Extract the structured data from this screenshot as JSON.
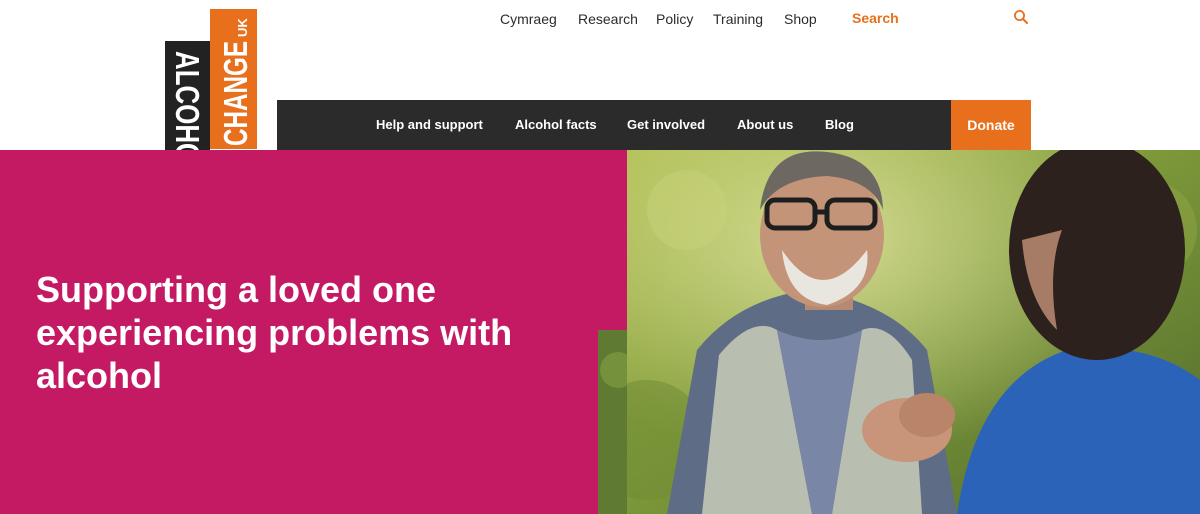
{
  "utility_nav": {
    "links": [
      "Cymraeg",
      "Research",
      "Policy",
      "Training",
      "Shop"
    ],
    "search_label": "Search",
    "search_icon": "search-icon"
  },
  "logo": {
    "word_one": "ALCOHOL",
    "word_two": "CHANGE",
    "suffix": "UK",
    "colors": {
      "dark": "#222222",
      "orange": "#e8701c"
    }
  },
  "main_nav": {
    "links": [
      "Help and support",
      "Alcohol facts",
      "Get involved",
      "About us",
      "Blog"
    ],
    "donate_label": "Donate"
  },
  "hero": {
    "title": "Supporting a loved one experiencing problems with alcohol",
    "image": "photo-older-man-holding-hands-with-woman-outdoors"
  },
  "colors": {
    "accent": "#e8701c",
    "hero_band": "#c41963",
    "nav_dark": "#2b2b2b"
  }
}
